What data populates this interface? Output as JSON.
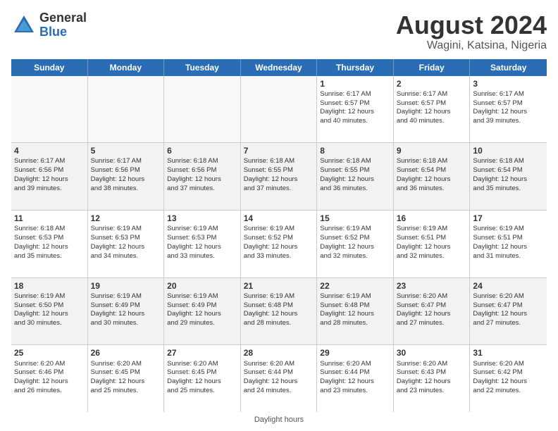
{
  "logo": {
    "general": "General",
    "blue": "Blue"
  },
  "title": {
    "month": "August 2024",
    "location": "Wagini, Katsina, Nigeria"
  },
  "header_days": [
    "Sunday",
    "Monday",
    "Tuesday",
    "Wednesday",
    "Thursday",
    "Friday",
    "Saturday"
  ],
  "footnote": "Daylight hours",
  "weeks": [
    [
      {
        "day": "",
        "content": "",
        "empty": true
      },
      {
        "day": "",
        "content": "",
        "empty": true
      },
      {
        "day": "",
        "content": "",
        "empty": true
      },
      {
        "day": "",
        "content": "",
        "empty": true
      },
      {
        "day": "1",
        "content": "Sunrise: 6:17 AM\nSunset: 6:57 PM\nDaylight: 12 hours\nand 40 minutes.",
        "empty": false
      },
      {
        "day": "2",
        "content": "Sunrise: 6:17 AM\nSunset: 6:57 PM\nDaylight: 12 hours\nand 40 minutes.",
        "empty": false
      },
      {
        "day": "3",
        "content": "Sunrise: 6:17 AM\nSunset: 6:57 PM\nDaylight: 12 hours\nand 39 minutes.",
        "empty": false
      }
    ],
    [
      {
        "day": "4",
        "content": "Sunrise: 6:17 AM\nSunset: 6:56 PM\nDaylight: 12 hours\nand 39 minutes.",
        "empty": false
      },
      {
        "day": "5",
        "content": "Sunrise: 6:17 AM\nSunset: 6:56 PM\nDaylight: 12 hours\nand 38 minutes.",
        "empty": false
      },
      {
        "day": "6",
        "content": "Sunrise: 6:18 AM\nSunset: 6:56 PM\nDaylight: 12 hours\nand 37 minutes.",
        "empty": false
      },
      {
        "day": "7",
        "content": "Sunrise: 6:18 AM\nSunset: 6:55 PM\nDaylight: 12 hours\nand 37 minutes.",
        "empty": false
      },
      {
        "day": "8",
        "content": "Sunrise: 6:18 AM\nSunset: 6:55 PM\nDaylight: 12 hours\nand 36 minutes.",
        "empty": false
      },
      {
        "day": "9",
        "content": "Sunrise: 6:18 AM\nSunset: 6:54 PM\nDaylight: 12 hours\nand 36 minutes.",
        "empty": false
      },
      {
        "day": "10",
        "content": "Sunrise: 6:18 AM\nSunset: 6:54 PM\nDaylight: 12 hours\nand 35 minutes.",
        "empty": false
      }
    ],
    [
      {
        "day": "11",
        "content": "Sunrise: 6:18 AM\nSunset: 6:53 PM\nDaylight: 12 hours\nand 35 minutes.",
        "empty": false
      },
      {
        "day": "12",
        "content": "Sunrise: 6:19 AM\nSunset: 6:53 PM\nDaylight: 12 hours\nand 34 minutes.",
        "empty": false
      },
      {
        "day": "13",
        "content": "Sunrise: 6:19 AM\nSunset: 6:53 PM\nDaylight: 12 hours\nand 33 minutes.",
        "empty": false
      },
      {
        "day": "14",
        "content": "Sunrise: 6:19 AM\nSunset: 6:52 PM\nDaylight: 12 hours\nand 33 minutes.",
        "empty": false
      },
      {
        "day": "15",
        "content": "Sunrise: 6:19 AM\nSunset: 6:52 PM\nDaylight: 12 hours\nand 32 minutes.",
        "empty": false
      },
      {
        "day": "16",
        "content": "Sunrise: 6:19 AM\nSunset: 6:51 PM\nDaylight: 12 hours\nand 32 minutes.",
        "empty": false
      },
      {
        "day": "17",
        "content": "Sunrise: 6:19 AM\nSunset: 6:51 PM\nDaylight: 12 hours\nand 31 minutes.",
        "empty": false
      }
    ],
    [
      {
        "day": "18",
        "content": "Sunrise: 6:19 AM\nSunset: 6:50 PM\nDaylight: 12 hours\nand 30 minutes.",
        "empty": false
      },
      {
        "day": "19",
        "content": "Sunrise: 6:19 AM\nSunset: 6:49 PM\nDaylight: 12 hours\nand 30 minutes.",
        "empty": false
      },
      {
        "day": "20",
        "content": "Sunrise: 6:19 AM\nSunset: 6:49 PM\nDaylight: 12 hours\nand 29 minutes.",
        "empty": false
      },
      {
        "day": "21",
        "content": "Sunrise: 6:19 AM\nSunset: 6:48 PM\nDaylight: 12 hours\nand 28 minutes.",
        "empty": false
      },
      {
        "day": "22",
        "content": "Sunrise: 6:19 AM\nSunset: 6:48 PM\nDaylight: 12 hours\nand 28 minutes.",
        "empty": false
      },
      {
        "day": "23",
        "content": "Sunrise: 6:20 AM\nSunset: 6:47 PM\nDaylight: 12 hours\nand 27 minutes.",
        "empty": false
      },
      {
        "day": "24",
        "content": "Sunrise: 6:20 AM\nSunset: 6:47 PM\nDaylight: 12 hours\nand 27 minutes.",
        "empty": false
      }
    ],
    [
      {
        "day": "25",
        "content": "Sunrise: 6:20 AM\nSunset: 6:46 PM\nDaylight: 12 hours\nand 26 minutes.",
        "empty": false
      },
      {
        "day": "26",
        "content": "Sunrise: 6:20 AM\nSunset: 6:45 PM\nDaylight: 12 hours\nand 25 minutes.",
        "empty": false
      },
      {
        "day": "27",
        "content": "Sunrise: 6:20 AM\nSunset: 6:45 PM\nDaylight: 12 hours\nand 25 minutes.",
        "empty": false
      },
      {
        "day": "28",
        "content": "Sunrise: 6:20 AM\nSunset: 6:44 PM\nDaylight: 12 hours\nand 24 minutes.",
        "empty": false
      },
      {
        "day": "29",
        "content": "Sunrise: 6:20 AM\nSunset: 6:44 PM\nDaylight: 12 hours\nand 23 minutes.",
        "empty": false
      },
      {
        "day": "30",
        "content": "Sunrise: 6:20 AM\nSunset: 6:43 PM\nDaylight: 12 hours\nand 23 minutes.",
        "empty": false
      },
      {
        "day": "31",
        "content": "Sunrise: 6:20 AM\nSunset: 6:42 PM\nDaylight: 12 hours\nand 22 minutes.",
        "empty": false
      }
    ]
  ]
}
